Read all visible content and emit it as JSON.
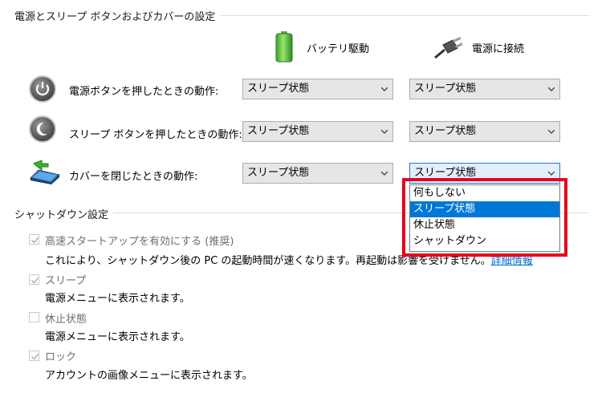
{
  "section_power": {
    "title": "電源とスリープ ボタンおよびカバーの設定"
  },
  "columns": {
    "battery": "バッテリ駆動",
    "plugged": "電源に接続"
  },
  "rows": [
    {
      "label": "電源ボタンを押したときの動作:",
      "battery_value": "スリープ状態",
      "plugged_value": "スリープ状態"
    },
    {
      "label": "スリープ ボタンを押したときの動作:",
      "battery_value": "スリープ状態",
      "plugged_value": "スリープ状態"
    },
    {
      "label": "カバーを閉じたときの動作:",
      "battery_value": "スリープ状態",
      "plugged_value": "スリープ状態"
    }
  ],
  "dropdown": {
    "options": [
      "何もしない",
      "スリープ状態",
      "休止状態",
      "シャットダウン"
    ],
    "selected_index": 1
  },
  "section_shutdown": {
    "title": "シャットダウン設定"
  },
  "shutdown_options": [
    {
      "title": "高速スタートアップを有効にする (推奨)",
      "checked": true,
      "desc": "これにより、シャットダウン後の PC の起動時間が速くなります。再起動は影響を受けません。",
      "link": "詳細情報"
    },
    {
      "title": "スリープ",
      "checked": true,
      "desc": "電源メニューに表示されます。"
    },
    {
      "title": "休止状態",
      "checked": false,
      "desc": "電源メニューに表示されます。"
    },
    {
      "title": "ロック",
      "checked": true,
      "desc": "アカウントの画像メニューに表示されます。"
    }
  ],
  "colors": {
    "highlight": "#e8001c",
    "selected_option": "#0078d7",
    "link": "#0066cc"
  }
}
